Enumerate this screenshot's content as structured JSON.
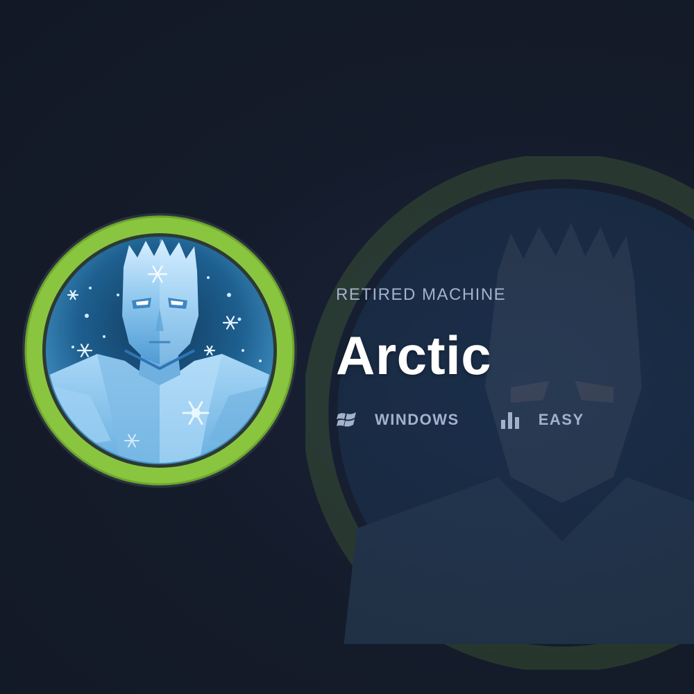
{
  "machine": {
    "status_label": "RETIRED MACHINE",
    "name": "Arctic",
    "os": "WINDOWS",
    "difficulty": "EASY",
    "os_icon": "windows-logo-icon",
    "difficulty_icon": "bar-chart-icon"
  },
  "colors": {
    "background": "#141b29",
    "ring": "#8ac540",
    "label": "#a4b1cd",
    "title": "#ffffff"
  }
}
